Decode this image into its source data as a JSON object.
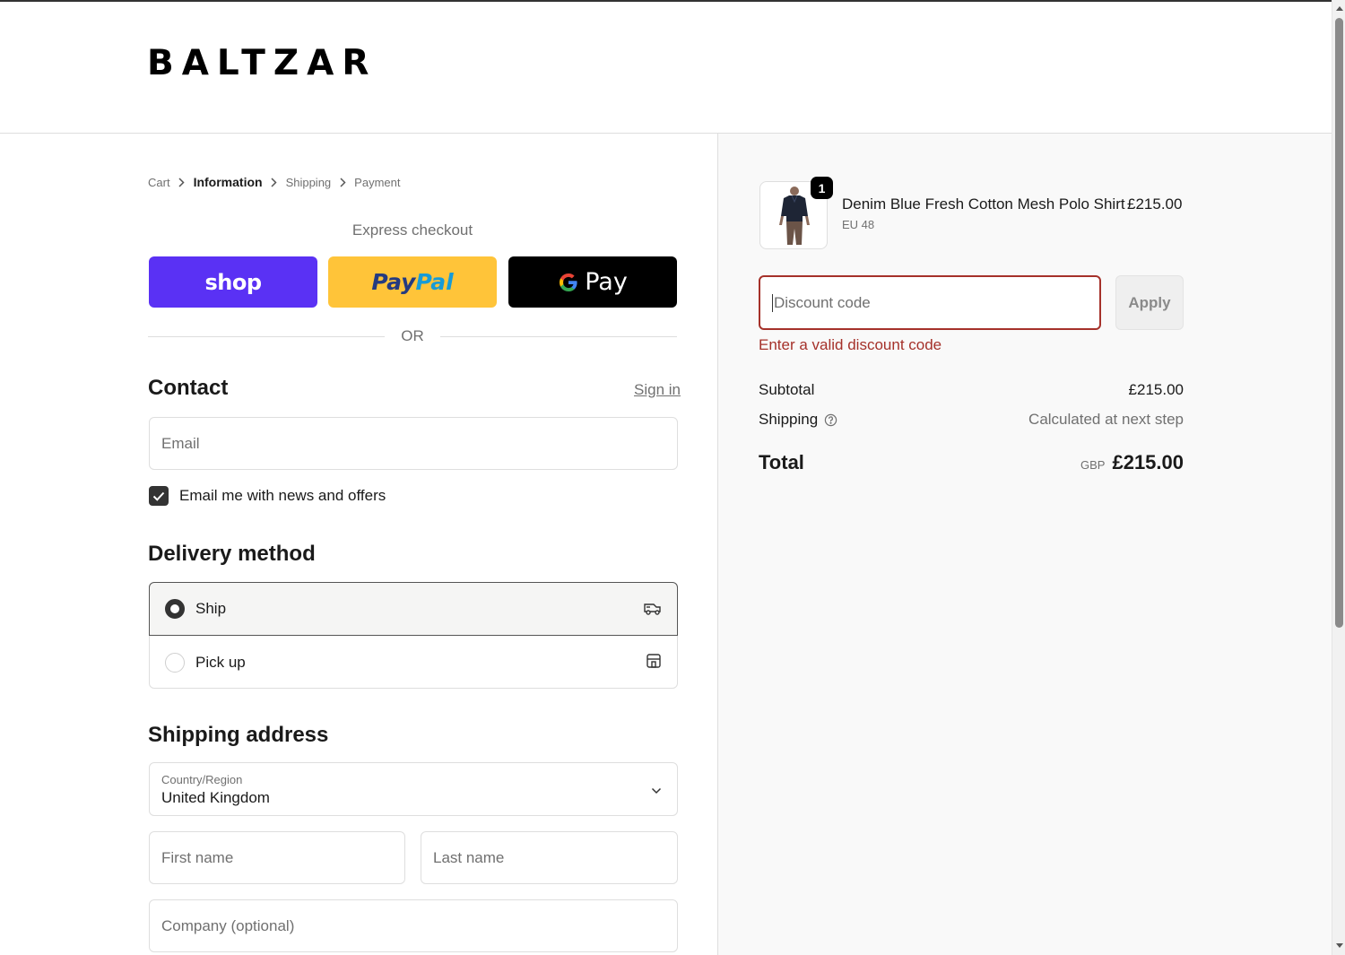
{
  "brand": {
    "logo": "BALTZAR"
  },
  "breadcrumb": {
    "items": [
      "Cart",
      "Information",
      "Shipping",
      "Payment"
    ],
    "active_index": 1
  },
  "express": {
    "label": "Express checkout",
    "shop_label": "shop",
    "paypal_part1": "Pay",
    "paypal_part2": "Pal",
    "gpay_label": "Pay",
    "or_text": "OR"
  },
  "contact": {
    "title": "Contact",
    "signin": "Sign in",
    "email_placeholder": "Email",
    "newsletter_label": "Email me with news and offers",
    "newsletter_checked": true
  },
  "delivery": {
    "title": "Delivery method",
    "options": [
      {
        "label": "Ship",
        "selected": true,
        "icon": "truck-icon"
      },
      {
        "label": "Pick up",
        "selected": false,
        "icon": "store-icon"
      }
    ]
  },
  "shipping_address": {
    "title": "Shipping address",
    "country_label": "Country/Region",
    "country_value": "United Kingdom",
    "first_name_placeholder": "First name",
    "last_name_placeholder": "Last name",
    "company_placeholder": "Company (optional)"
  },
  "order": {
    "item": {
      "quantity": "1",
      "name": "Denim Blue Fresh Cotton Mesh Polo Shirt",
      "variant": "EU 48",
      "price": "£215.00"
    },
    "discount": {
      "placeholder": "Discount code",
      "apply_label": "Apply",
      "error": "Enter a valid discount code"
    },
    "subtotal_label": "Subtotal",
    "subtotal_value": "£215.00",
    "shipping_label": "Shipping",
    "shipping_value": "Calculated at next step",
    "total_label": "Total",
    "total_currency": "GBP",
    "total_value": "£215.00"
  },
  "colors": {
    "shop_purple": "#5a31f4",
    "paypal_yellow": "#ffc439",
    "error_red": "#a5312a",
    "summary_bg": "#f9f9f9"
  }
}
